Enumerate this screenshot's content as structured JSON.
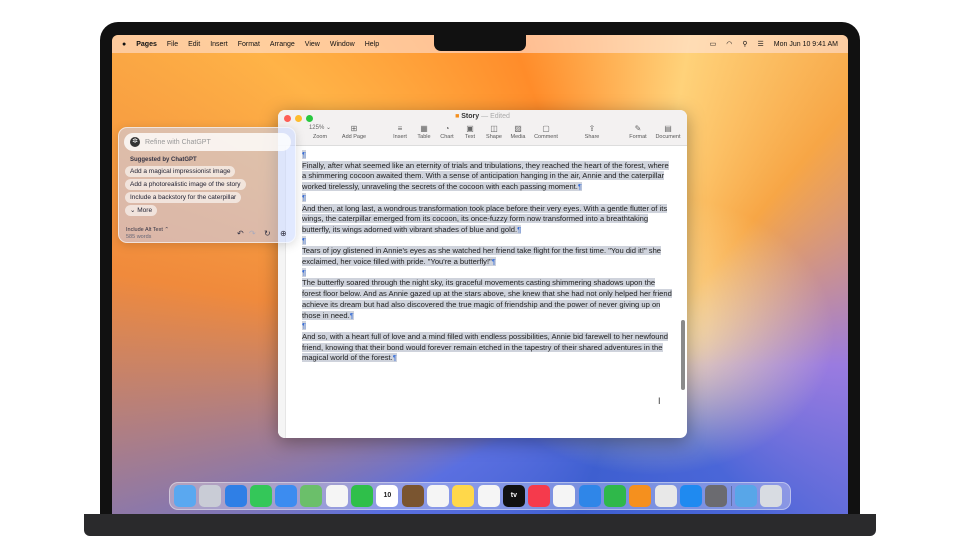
{
  "menubar": {
    "app": "Pages",
    "items": [
      "File",
      "Edit",
      "Insert",
      "Format",
      "Arrange",
      "View",
      "Window",
      "Help"
    ],
    "clock": "Mon Jun 10  9:41 AM"
  },
  "window": {
    "title": "Story",
    "status": "— Edited",
    "toolbar": [
      {
        "label": "Zoom",
        "value": "125%",
        "icon": "chevron-down-icon"
      },
      {
        "label": "Add Page",
        "icon": "plus-square-icon"
      },
      {
        "label": "Insert",
        "icon": "insert-icon"
      },
      {
        "label": "Table",
        "icon": "table-icon"
      },
      {
        "label": "Chart",
        "icon": "chart-icon"
      },
      {
        "label": "Text",
        "icon": "text-box-icon"
      },
      {
        "label": "Shape",
        "icon": "shape-icon"
      },
      {
        "label": "Media",
        "icon": "media-icon"
      },
      {
        "label": "Comment",
        "icon": "comment-icon"
      },
      {
        "label": "Share",
        "icon": "share-icon"
      },
      {
        "label": "Format",
        "icon": "format-brush-icon"
      },
      {
        "label": "Document",
        "icon": "document-icon"
      }
    ],
    "paragraphs": [
      "Finally, after what seemed like an eternity of trials and tribulations, they reached the heart of the forest, where a shimmering cocoon awaited them. With a sense of anticipation hanging in the air, Annie and the caterpillar worked tirelessly, unraveling the secrets of the cocoon with each passing moment.",
      "And then, at long last, a wondrous transformation took place before their very eyes. With a gentle flutter of its wings, the caterpillar emerged from its cocoon, its once-fuzzy form now transformed into a breathtaking butterfly, its wings adorned with vibrant shades of blue and gold.",
      "Tears of joy glistened in Annie's eyes as she watched her friend take flight for the first time. \"You did it!\" she exclaimed, her voice filled with pride. \"You're a butterfly!\"",
      "The butterfly soared through the night sky, its graceful movements casting shimmering shadows upon the forest floor below. And as Annie gazed up at the stars above, she knew that she had not only helped her friend achieve its dream but had also discovered the true magic of friendship and the power of never giving up on those in need.",
      "And so, with a heart full of love and a mind filled with endless possibilities, Annie bid farewell to her newfound friend, knowing that their bond would forever remain etched in the tapestry of their shared adventures in the magical world of the forest."
    ],
    "pilcrow": "¶"
  },
  "chatgpt": {
    "placeholder": "Refine with ChatGPT",
    "suggested_heading": "Suggested by ChatGPT",
    "suggestions": [
      "Add a magical impressionist image",
      "Add a photorealistic image of the story",
      "Include a backstory for the caterpillar"
    ],
    "more": "More",
    "include": "Include Alt Text ⌃",
    "words": "585 words"
  },
  "dock": [
    {
      "name": "finder",
      "color": "#5aa8f0"
    },
    {
      "name": "launchpad",
      "color": "#c9ccd6"
    },
    {
      "name": "safari",
      "color": "#2f7fe6"
    },
    {
      "name": "messages",
      "color": "#34c759"
    },
    {
      "name": "mail",
      "color": "#3c8cf0"
    },
    {
      "name": "maps",
      "color": "#6bbf6a"
    },
    {
      "name": "photos",
      "color": "#f5f5f5"
    },
    {
      "name": "facetime",
      "color": "#2fbf4a"
    },
    {
      "name": "calendar",
      "color": "#ffffff",
      "text": "10"
    },
    {
      "name": "brown-app",
      "color": "#7a5530"
    },
    {
      "name": "reminders",
      "color": "#f5f5f5"
    },
    {
      "name": "notes",
      "color": "#ffd84a"
    },
    {
      "name": "freeform",
      "color": "#f5f5f5"
    },
    {
      "name": "tv",
      "color": "#111111",
      "text": "tv"
    },
    {
      "name": "music",
      "color": "#f53a4c"
    },
    {
      "name": "news",
      "color": "#f5f5f5"
    },
    {
      "name": "keynote",
      "color": "#2f86e8"
    },
    {
      "name": "numbers",
      "color": "#2fb84a"
    },
    {
      "name": "pages",
      "color": "#f5901e"
    },
    {
      "name": "iphone-mirroring",
      "color": "#e8e8e8"
    },
    {
      "name": "app-store",
      "color": "#1f8af0"
    },
    {
      "name": "system-settings",
      "color": "#6b6b70"
    },
    {
      "name": "downloads",
      "color": "#58a6e8"
    },
    {
      "name": "trash",
      "color": "#d8dce2"
    }
  ]
}
